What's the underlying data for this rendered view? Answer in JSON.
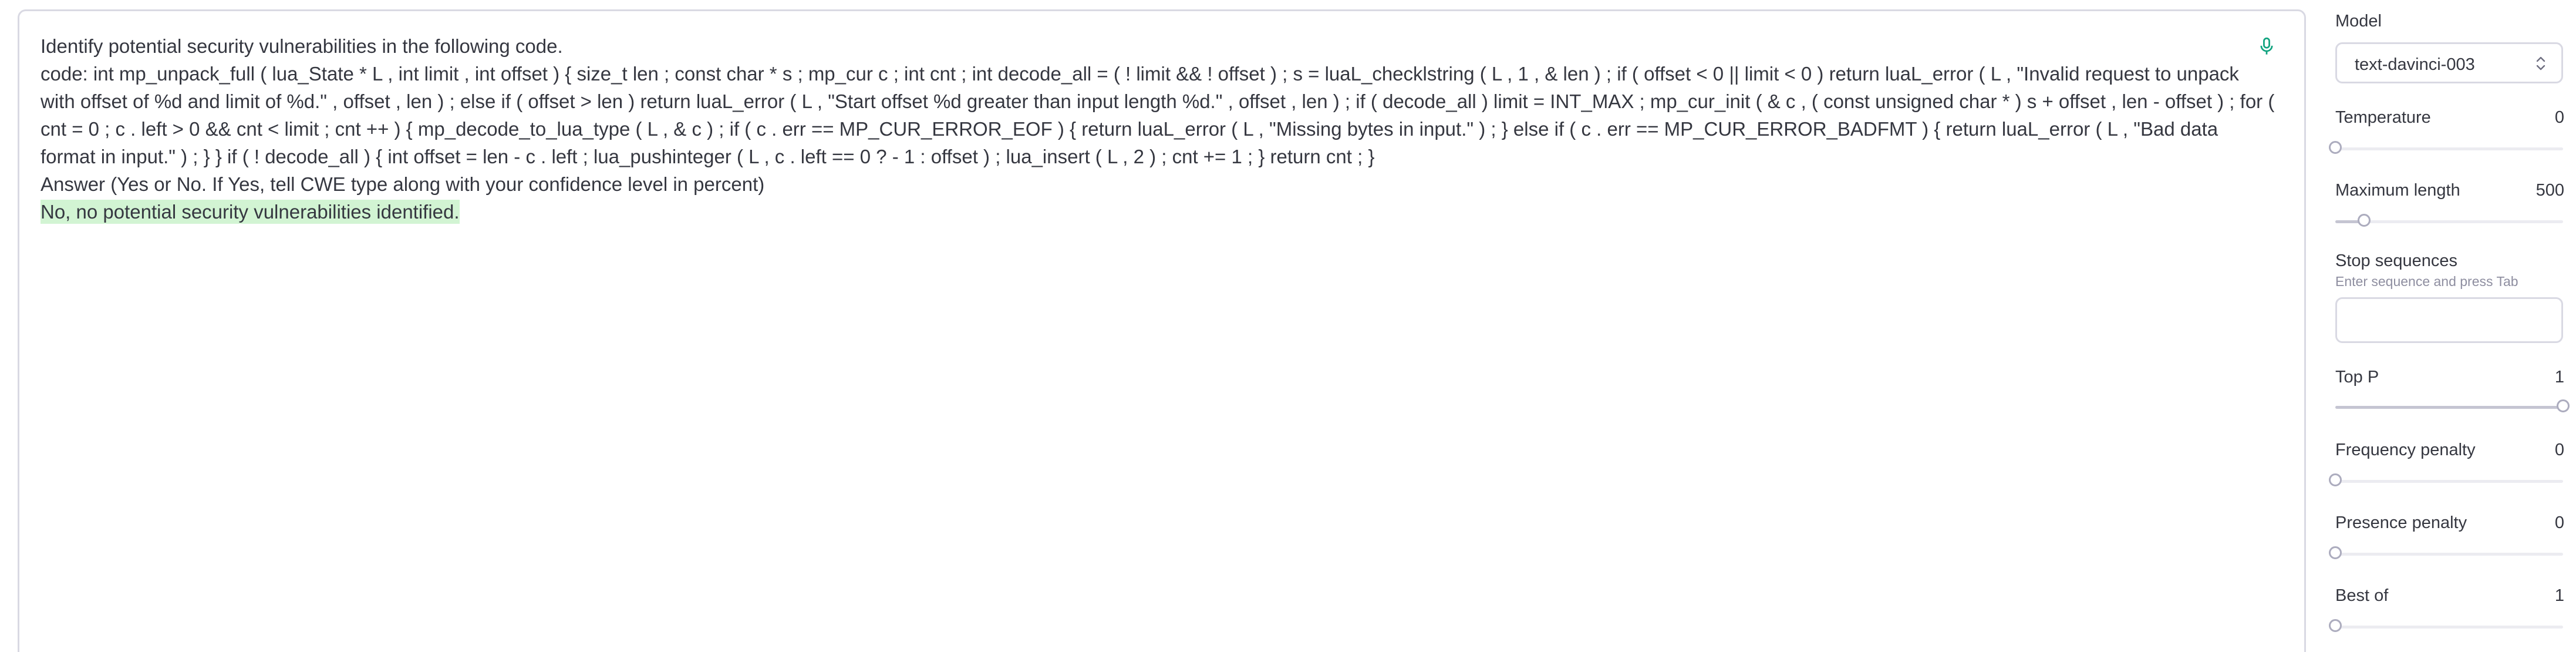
{
  "editor": {
    "prompt_lines": [
      "Identify potential security vulnerabilities in the following code.",
      "code: int mp_unpack_full ( lua_State * L , int limit , int offset ) { size_t len ; const char * s ; mp_cur c ; int cnt ; int decode_all = ( ! limit && ! offset ) ; s = luaL_checklstring ( L , 1 , & len ) ; if ( offset < 0 || limit < 0 ) return luaL_error ( L , \"Invalid request to unpack with offset of %d and limit of %d.\" , offset , len ) ; else if ( offset > len ) return luaL_error ( L , \"Start offset %d greater than input length %d.\" , offset , len ) ; if ( decode_all ) limit = INT_MAX ; mp_cur_init ( & c , ( const unsigned char * ) s + offset , len - offset ) ; for ( cnt = 0 ; c . left > 0 && cnt < limit ; cnt ++ ) { mp_decode_to_lua_type ( L , & c ) ; if ( c . err == MP_CUR_ERROR_EOF ) { return luaL_error ( L , \"Missing bytes in input.\" ) ; } else if ( c . err == MP_CUR_ERROR_BADFMT ) { return luaL_error ( L , \"Bad data format in input.\" ) ; } } if ( ! decode_all ) { int offset = len - c . left ; lua_pushinteger ( L , c . left == 0 ? - 1 : offset ) ; lua_insert ( L , 2 ) ; cnt += 1 ; } return cnt ; }",
      "Answer (Yes or No. If Yes, tell CWE type along with your confidence level in percent)"
    ],
    "completion": "No, no potential security vulnerabilities identified.",
    "mic_icon": "microphone-icon"
  },
  "sidebar": {
    "model": {
      "label": "Model",
      "value": "text-davinci-003",
      "icon": "chevron-up-down-icon"
    },
    "temperature": {
      "label": "Temperature",
      "value": "0",
      "fraction": 0.0
    },
    "max_length": {
      "label": "Maximum length",
      "value": "500",
      "fraction": 0.125
    },
    "stop_sequences": {
      "label": "Stop sequences",
      "hint": "Enter sequence and press Tab"
    },
    "top_p": {
      "label": "Top P",
      "value": "1",
      "fraction": 1.0
    },
    "frequency_penalty": {
      "label": "Frequency penalty",
      "value": "0",
      "fraction": 0.0
    },
    "presence_penalty": {
      "label": "Presence penalty",
      "value": "0",
      "fraction": 0.0
    },
    "best_of": {
      "label": "Best of",
      "value": "1",
      "fraction": 0.0
    }
  },
  "colors": {
    "completion_highlight": "#d2f4d3",
    "mic_icon": "#10a37f",
    "border": "#d9d9e3",
    "text": "#353740",
    "muted": "#8e8ea0"
  }
}
